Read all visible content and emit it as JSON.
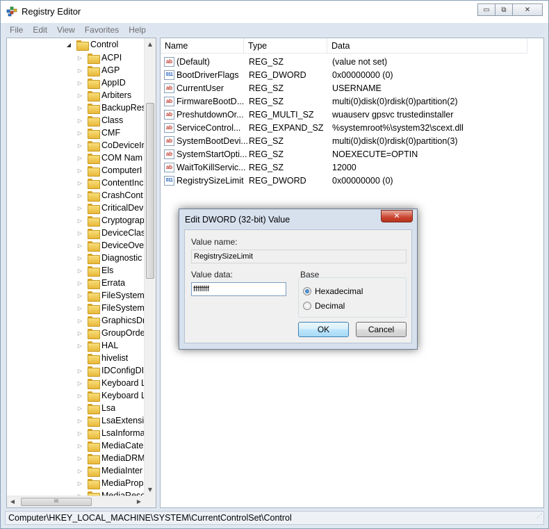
{
  "window": {
    "title": "Registry Editor",
    "icon": "registry-editor-icon",
    "controls": {
      "minimize": "▭",
      "maximize": "⧉",
      "close": "✕"
    }
  },
  "menu": [
    "File",
    "Edit",
    "View",
    "Favorites",
    "Help"
  ],
  "tree": {
    "expanded_node": "Control",
    "children": [
      "ACPI",
      "AGP",
      "AppID",
      "Arbiters",
      "BackupRes",
      "Class",
      "CMF",
      "CoDeviceIr",
      "COM Nam",
      "ComputerI",
      "ContentInc",
      "CrashCont",
      "CriticalDev",
      "Cryptograp",
      "DeviceClas",
      "DeviceOve",
      "Diagnostic",
      "Els",
      "Errata",
      "FileSystem",
      "FileSystem",
      "GraphicsDr",
      "GroupOrde",
      "HAL",
      "hivelist",
      "IDConfigDI",
      "Keyboard L",
      "Keyboard L",
      "Lsa",
      "LsaExtensic",
      "LsaInforma",
      "MediaCate",
      "MediaDRM",
      "MediaInter",
      "MediaProp",
      "MediaReso"
    ],
    "no_expander": [
      "hivelist"
    ],
    "hscroll_thumb_glyph": "III"
  },
  "columns": {
    "name": "Name",
    "type": "Type",
    "data": "Data"
  },
  "values": [
    {
      "name": "(Default)",
      "type": "REG_SZ",
      "data": "(value not set)",
      "icon": "string"
    },
    {
      "name": "BootDriverFlags",
      "type": "REG_DWORD",
      "data": "0x00000000 (0)",
      "icon": "binary"
    },
    {
      "name": "CurrentUser",
      "type": "REG_SZ",
      "data": "USERNAME",
      "icon": "string"
    },
    {
      "name": "FirmwareBootD...",
      "type": "REG_SZ",
      "data": "multi(0)disk(0)rdisk(0)partition(2)",
      "icon": "string"
    },
    {
      "name": "PreshutdownOr...",
      "type": "REG_MULTI_SZ",
      "data": "wuauserv gpsvc trustedinstaller",
      "icon": "string"
    },
    {
      "name": "ServiceControl...",
      "type": "REG_EXPAND_SZ",
      "data": "%systemroot%\\system32\\scext.dll",
      "icon": "string"
    },
    {
      "name": "SystemBootDevi...",
      "type": "REG_SZ",
      "data": "multi(0)disk(0)rdisk(0)partition(3)",
      "icon": "string"
    },
    {
      "name": "SystemStartOpti...",
      "type": "REG_SZ",
      "data": " NOEXECUTE=OPTIN",
      "icon": "string"
    },
    {
      "name": "WaitToKillServic...",
      "type": "REG_SZ",
      "data": "12000",
      "icon": "string"
    },
    {
      "name": "RegistrySizeLimit",
      "type": "REG_DWORD",
      "data": "0x00000000 (0)",
      "icon": "binary"
    }
  ],
  "icon_glyphs": {
    "string": "ab",
    "binary": "011"
  },
  "statusbar": {
    "path": "Computer\\HKEY_LOCAL_MACHINE\\SYSTEM\\CurrentControlSet\\Control"
  },
  "dialog": {
    "title": "Edit DWORD (32-bit) Value",
    "close_glyph": "✕",
    "value_name_label": "Value name:",
    "value_name": "RegistrySizeLimit",
    "value_data_label": "Value data:",
    "value_data": "ffffffff",
    "base_label": "Base",
    "base_options": [
      "Hexadecimal",
      "Decimal"
    ],
    "base_selected": "Hexadecimal",
    "ok_label": "OK",
    "cancel_label": "Cancel"
  }
}
